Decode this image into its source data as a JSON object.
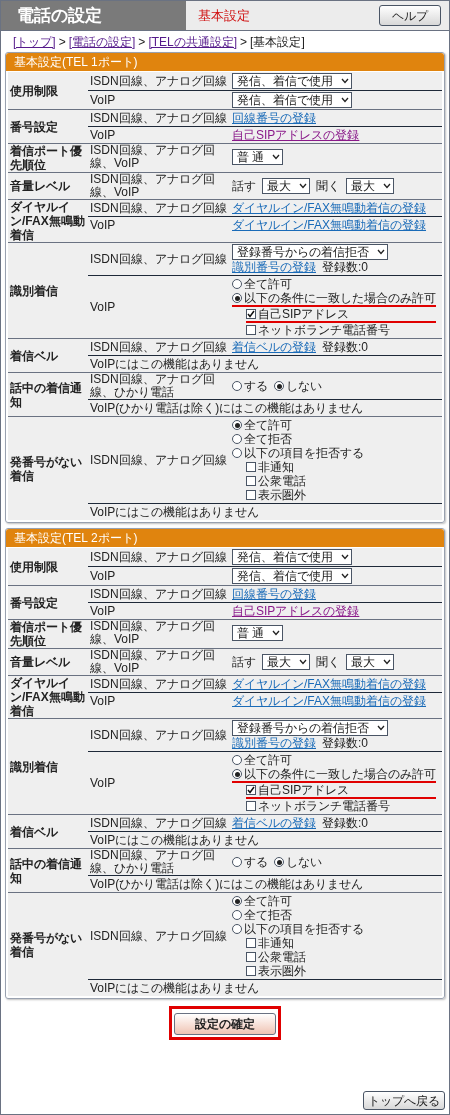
{
  "header": {
    "title": "電話の設定",
    "subtitle": "基本設定",
    "help_button": "ヘルプ"
  },
  "breadcrumb": [
    {
      "text": "[トップ]",
      "link": true,
      "separator": ">"
    },
    {
      "text": "[電話の設定]",
      "link": true,
      "separator": ">"
    },
    {
      "text": "[TELの共通設定]",
      "link": true,
      "separator": ">"
    },
    {
      "text": "[基本設定]",
      "link": false
    }
  ],
  "sections": [
    {
      "title": "基本設定(TEL 1ポート)",
      "rows": [
        {
          "label": "使用制限",
          "subrows": [
            {
              "label": "ISDN回線、アナログ回線",
              "lines": [
                [
                  {
                    "kind": "select",
                    "value": "発信、着信で使用"
                  }
                ]
              ]
            },
            {
              "label": "VoIP",
              "lines": [
                [
                  {
                    "kind": "select",
                    "value": "発信、着信で使用"
                  }
                ]
              ]
            }
          ]
        },
        {
          "label": "番号設定",
          "subrows": [
            {
              "label": "ISDN回線、アナログ回線",
              "lines": [
                [
                  {
                    "kind": "link",
                    "text": "回線番号の登録",
                    "visited": false
                  }
                ]
              ]
            },
            {
              "label": "VoIP",
              "lines": [
                [
                  {
                    "kind": "link",
                    "text": "自己SIPアドレスの登録",
                    "visited": true
                  }
                ]
              ]
            }
          ]
        },
        {
          "label": "着信ポート優先順位",
          "subrows": [
            {
              "label": "ISDN回線、アナログ回線、VoIP",
              "lines": [
                [
                  {
                    "kind": "select",
                    "value": "普 通"
                  }
                ]
              ]
            }
          ]
        },
        {
          "label": "音量レベル",
          "subrows": [
            {
              "label": "ISDN回線、アナログ回線、VoIP",
              "lines": [
                [
                  {
                    "kind": "text",
                    "text": "話す"
                  },
                  {
                    "kind": "select",
                    "value": "最大"
                  },
                  {
                    "kind": "text",
                    "text": "聞く"
                  },
                  {
                    "kind": "select",
                    "value": "最大"
                  }
                ]
              ]
            }
          ]
        },
        {
          "label": "ダイヤルイン/FAX無鳴動着信",
          "subrows": [
            {
              "label": "ISDN回線、アナログ回線",
              "lines": [
                [
                  {
                    "kind": "link",
                    "text": "ダイヤルイン/FAX無鳴動着信の登録",
                    "visited": false
                  }
                ]
              ]
            },
            {
              "label": "VoIP",
              "lines": [
                [
                  {
                    "kind": "link",
                    "text": "ダイヤルイン/FAX無鳴動着信の登録",
                    "visited": false
                  }
                ]
              ]
            }
          ]
        },
        {
          "label": "識別着信",
          "subrows": [
            {
              "label": "ISDN回線、アナログ回線",
              "lines": [
                [
                  {
                    "kind": "select",
                    "value": "登録番号からの着信拒否"
                  }
                ],
                [
                  {
                    "kind": "link",
                    "text": "識別番号の登録",
                    "visited": false
                  },
                  {
                    "kind": "text",
                    "text": "登録数:0"
                  }
                ]
              ]
            },
            {
              "label": "VoIP",
              "lines": [
                [
                  {
                    "kind": "radio",
                    "label": "全て許可",
                    "selected": false
                  }
                ],
                [
                  {
                    "kind": "radio",
                    "label": "以下の条件に一致した場合のみ許可",
                    "selected": true,
                    "highlighted": true,
                    "children": [
                      {
                        "kind": "checkbox",
                        "label": "自己SIPアドレス",
                        "checked": true,
                        "highlighted": true
                      },
                      {
                        "kind": "checkbox",
                        "label": "ネットボランチ電話番号",
                        "checked": false
                      }
                    ]
                  }
                ]
              ]
            }
          ]
        },
        {
          "label": "着信ベル",
          "subrows": [
            {
              "label": "ISDN回線、アナログ回線",
              "lines": [
                [
                  {
                    "kind": "link",
                    "text": "着信ベルの登録",
                    "visited": false
                  },
                  {
                    "kind": "text",
                    "text": "登録数:0"
                  }
                ]
              ]
            },
            {
              "note": "VoIPにはこの機能はありません"
            }
          ]
        },
        {
          "label": "話中の着信通知",
          "subrows": [
            {
              "label": "ISDN回線、アナログ回線、ひかり電話",
              "lines": [
                [
                  {
                    "kind": "radio",
                    "label": "する",
                    "selected": false
                  },
                  {
                    "kind": "radio",
                    "label": "しない",
                    "selected": true
                  }
                ]
              ]
            },
            {
              "note": "VoIP(ひかり電話は除く)にはこの機能はありません"
            }
          ]
        },
        {
          "label": "発番号がない着信",
          "subrows": [
            {
              "label": "ISDN回線、アナログ回線",
              "lines": [
                [
                  {
                    "kind": "radio",
                    "label": "全て許可",
                    "selected": true
                  }
                ],
                [
                  {
                    "kind": "radio",
                    "label": "全て拒否",
                    "selected": false
                  }
                ],
                [
                  {
                    "kind": "radio",
                    "label": "以下の項目を拒否する",
                    "selected": false,
                    "children": [
                      {
                        "kind": "checkbox",
                        "label": "非通知",
                        "checked": false
                      },
                      {
                        "kind": "checkbox",
                        "label": "公衆電話",
                        "checked": false
                      },
                      {
                        "kind": "checkbox",
                        "label": "表示圏外",
                        "checked": false
                      }
                    ]
                  }
                ]
              ]
            },
            {
              "note": "VoIPにはこの機能はありません"
            }
          ]
        }
      ]
    },
    {
      "title": "基本設定(TEL 2ポート)",
      "rows": [
        {
          "label": "使用制限",
          "subrows": [
            {
              "label": "ISDN回線、アナログ回線",
              "lines": [
                [
                  {
                    "kind": "select",
                    "value": "発信、着信で使用"
                  }
                ]
              ]
            },
            {
              "label": "VoIP",
              "lines": [
                [
                  {
                    "kind": "select",
                    "value": "発信、着信で使用"
                  }
                ]
              ]
            }
          ]
        },
        {
          "label": "番号設定",
          "subrows": [
            {
              "label": "ISDN回線、アナログ回線",
              "lines": [
                [
                  {
                    "kind": "link",
                    "text": "回線番号の登録",
                    "visited": false
                  }
                ]
              ]
            },
            {
              "label": "VoIP",
              "lines": [
                [
                  {
                    "kind": "link",
                    "text": "自己SIPアドレスの登録",
                    "visited": true
                  }
                ]
              ]
            }
          ]
        },
        {
          "label": "着信ポート優先順位",
          "subrows": [
            {
              "label": "ISDN回線、アナログ回線、VoIP",
              "lines": [
                [
                  {
                    "kind": "select",
                    "value": "普 通"
                  }
                ]
              ]
            }
          ]
        },
        {
          "label": "音量レベル",
          "subrows": [
            {
              "label": "ISDN回線、アナログ回線、VoIP",
              "lines": [
                [
                  {
                    "kind": "text",
                    "text": "話す"
                  },
                  {
                    "kind": "select",
                    "value": "最大"
                  },
                  {
                    "kind": "text",
                    "text": "聞く"
                  },
                  {
                    "kind": "select",
                    "value": "最大"
                  }
                ]
              ]
            }
          ]
        },
        {
          "label": "ダイヤルイン/FAX無鳴動着信",
          "subrows": [
            {
              "label": "ISDN回線、アナログ回線",
              "lines": [
                [
                  {
                    "kind": "link",
                    "text": "ダイヤルイン/FAX無鳴動着信の登録",
                    "visited": false
                  }
                ]
              ]
            },
            {
              "label": "VoIP",
              "lines": [
                [
                  {
                    "kind": "link",
                    "text": "ダイヤルイン/FAX無鳴動着信の登録",
                    "visited": false
                  }
                ]
              ]
            }
          ]
        },
        {
          "label": "識別着信",
          "subrows": [
            {
              "label": "ISDN回線、アナログ回線",
              "lines": [
                [
                  {
                    "kind": "select",
                    "value": "登録番号からの着信拒否"
                  }
                ],
                [
                  {
                    "kind": "link",
                    "text": "識別番号の登録",
                    "visited": false
                  },
                  {
                    "kind": "text",
                    "text": "登録数:0"
                  }
                ]
              ]
            },
            {
              "label": "VoIP",
              "lines": [
                [
                  {
                    "kind": "radio",
                    "label": "全て許可",
                    "selected": false
                  }
                ],
                [
                  {
                    "kind": "radio",
                    "label": "以下の条件に一致した場合のみ許可",
                    "selected": true,
                    "highlighted": true,
                    "children": [
                      {
                        "kind": "checkbox",
                        "label": "自己SIPアドレス",
                        "checked": true,
                        "highlighted": true
                      },
                      {
                        "kind": "checkbox",
                        "label": "ネットボランチ電話番号",
                        "checked": false
                      }
                    ]
                  }
                ]
              ]
            }
          ]
        },
        {
          "label": "着信ベル",
          "subrows": [
            {
              "label": "ISDN回線、アナログ回線",
              "lines": [
                [
                  {
                    "kind": "link",
                    "text": "着信ベルの登録",
                    "visited": false
                  },
                  {
                    "kind": "text",
                    "text": "登録数:0"
                  }
                ]
              ]
            },
            {
              "note": "VoIPにはこの機能はありません"
            }
          ]
        },
        {
          "label": "話中の着信通知",
          "subrows": [
            {
              "label": "ISDN回線、アナログ回線、ひかり電話",
              "lines": [
                [
                  {
                    "kind": "radio",
                    "label": "する",
                    "selected": false
                  },
                  {
                    "kind": "radio",
                    "label": "しない",
                    "selected": true
                  }
                ]
              ]
            },
            {
              "note": "VoIP(ひかり電話は除く)にはこの機能はありません"
            }
          ]
        },
        {
          "label": "発番号がない着信",
          "subrows": [
            {
              "label": "ISDN回線、アナログ回線",
              "lines": [
                [
                  {
                    "kind": "radio",
                    "label": "全て許可",
                    "selected": true
                  }
                ],
                [
                  {
                    "kind": "radio",
                    "label": "全て拒否",
                    "selected": false
                  }
                ],
                [
                  {
                    "kind": "radio",
                    "label": "以下の項目を拒否する",
                    "selected": false,
                    "children": [
                      {
                        "kind": "checkbox",
                        "label": "非通知",
                        "checked": false
                      },
                      {
                        "kind": "checkbox",
                        "label": "公衆電話",
                        "checked": false
                      },
                      {
                        "kind": "checkbox",
                        "label": "表示圏外",
                        "checked": false
                      }
                    ]
                  }
                ]
              ]
            },
            {
              "note": "VoIPにはこの機能はありません"
            }
          ]
        }
      ]
    }
  ],
  "confirm_button": {
    "label": "設定の確定",
    "highlighted": true
  },
  "back_button": "トップへ戻る"
}
